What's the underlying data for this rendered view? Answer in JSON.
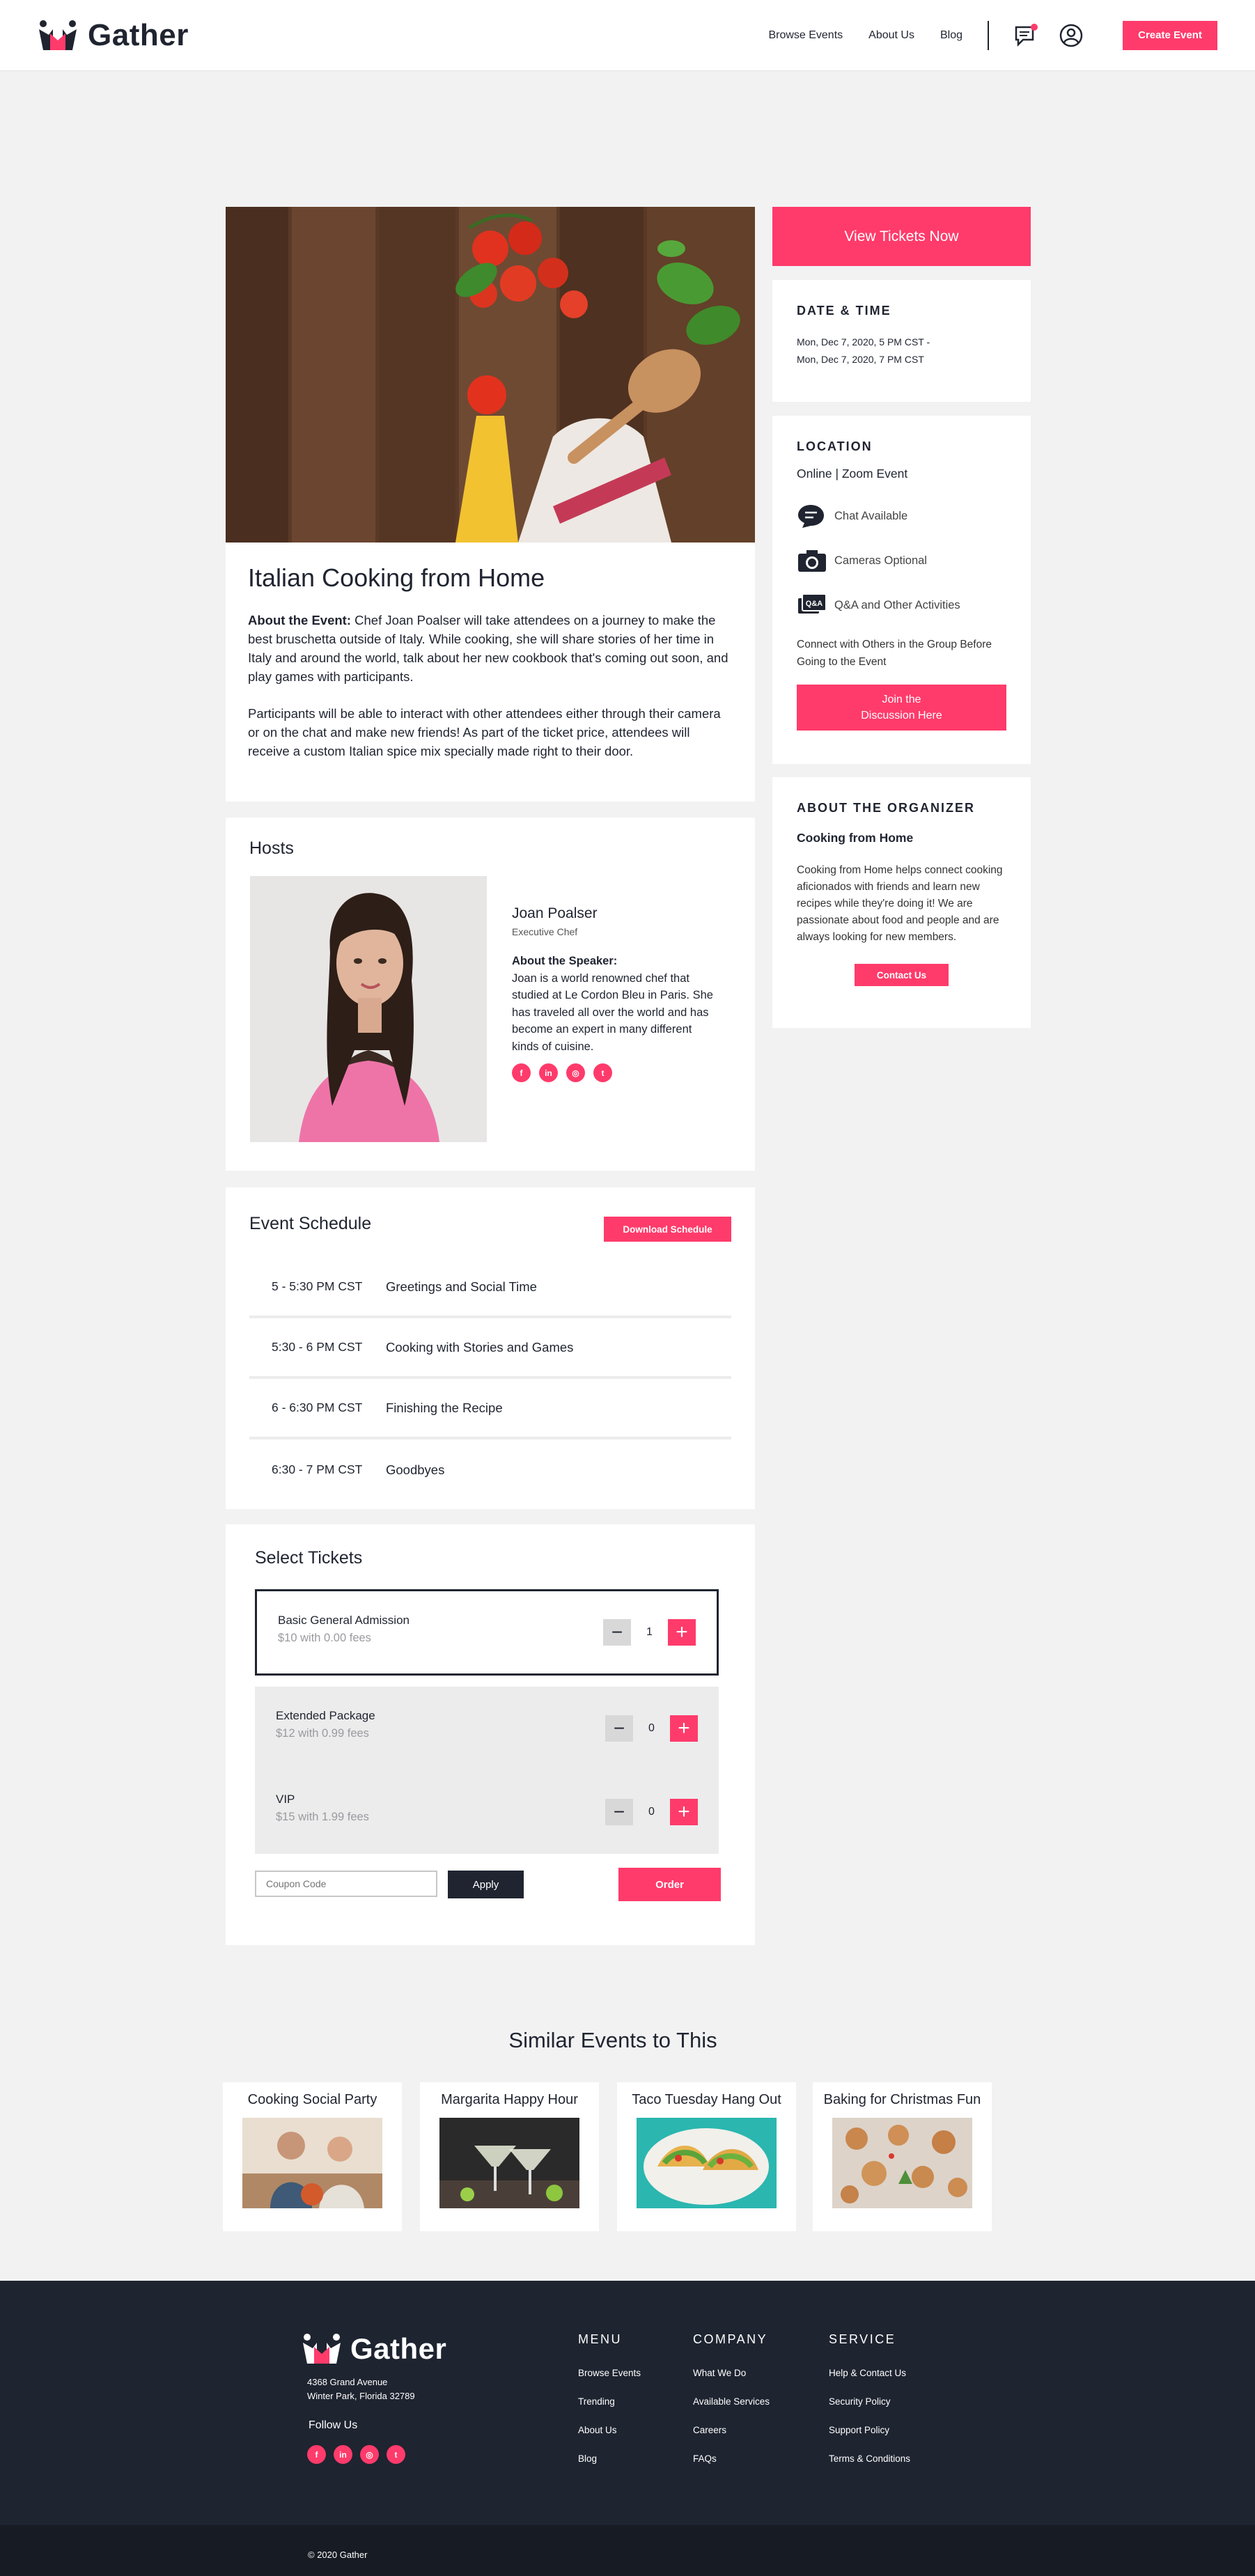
{
  "header": {
    "brand": "Gather",
    "nav": [
      "Browse Events",
      "About Us",
      "Blog"
    ],
    "create_label": "Create Event"
  },
  "event": {
    "title": "Italian Cooking from Home",
    "about_lead": "About the Event:",
    "about_text": " Chef Joan Poalser will take attendees on a journey to make the best bruschetta outside of Italy. While cooking, she will share stories of her time in Italy and around the world, talk about her new cookbook that's coming out soon, and play games with participants.",
    "about_text2": "Participants will be able to interact with other attendees either through their camera or on the chat and make new friends! As part of the ticket price, attendees will receive a custom Italian spice mix specially made right to their door."
  },
  "hosts": {
    "heading": "Hosts",
    "name": "Joan Poalser",
    "role": "Executive Chef",
    "bio_lead": "About the Speaker:",
    "bio": "Joan is a world renowned chef that studied at Le Cordon Bleu in Paris. She has traveled all over the world and has become an expert in many different kinds of cuisine."
  },
  "schedule": {
    "heading": "Event Schedule",
    "download_label": "Download Schedule",
    "items": [
      {
        "time": "5 - 5:30 PM CST",
        "title": "Greetings and Social Time"
      },
      {
        "time": "5:30 - 6 PM CST",
        "title": "Cooking with Stories and Games"
      },
      {
        "time": "6 - 6:30 PM CST",
        "title": "Finishing the Recipe"
      },
      {
        "time": "6:30 - 7 PM CST",
        "title": "Goodbyes"
      }
    ]
  },
  "tickets": {
    "heading": "Select Tickets",
    "items": [
      {
        "name": "Basic General Admission",
        "price": "$10 with 0.00 fees",
        "qty": "1"
      },
      {
        "name": "Extended Package",
        "price": "$12 with 0.99 fees",
        "qty": "0"
      },
      {
        "name": "VIP",
        "price": "$15 with 1.99 fees",
        "qty": "0"
      }
    ],
    "coupon_placeholder": "Coupon Code",
    "apply_label": "Apply",
    "order_label": "Order"
  },
  "sidebar": {
    "view_tickets_label": "View Tickets Now",
    "datetime_heading": "DATE & TIME",
    "datetime_line1": "Mon, Dec 7, 2020, 5 PM CST -",
    "datetime_line2": "Mon, Dec 7, 2020, 7 PM CST",
    "location_heading": "LOCATION",
    "location_type": "Online | Zoom Event",
    "features": [
      "Chat Available",
      "Cameras Optional",
      "Q&A and Other Activities"
    ],
    "connect_text": "Connect with Others in the Group Before Going to the Event",
    "join_line1": "Join the",
    "join_line2": "Discussion Here",
    "organizer_heading": "ABOUT THE ORGANIZER",
    "organizer_name": "Cooking from Home",
    "organizer_text": "Cooking from Home helps connect cooking aficionados with friends and learn new recipes while they're doing it! We are passionate about food and people and are always looking for new members.",
    "contact_label": "Contact Us"
  },
  "similar": {
    "heading": "Similar Events to This",
    "items": [
      "Cooking Social Party",
      "Margarita Happy Hour",
      "Taco Tuesday Hang Out",
      "Baking for Christmas Fun"
    ]
  },
  "footer": {
    "brand": "Gather",
    "address1": "4368 Grand Avenue",
    "address2": "Winter Park, Florida 32789",
    "follow": "Follow Us",
    "menu_heading": "MENU",
    "menu": [
      "Browse Events",
      "Trending",
      "About Us",
      "Blog"
    ],
    "company_heading": "COMPANY",
    "company": [
      "What We Do",
      "Available Services",
      "Careers",
      "FAQs"
    ],
    "service_heading": "SERVICE",
    "service": [
      "Help & Contact Us",
      "Security Policy",
      "Support Policy",
      "Terms & Conditions"
    ],
    "copyright": "© 2020 Gather"
  },
  "colors": {
    "accent": "#ff3b6b",
    "dark": "#1e2430",
    "background": "#f2f2f3"
  }
}
